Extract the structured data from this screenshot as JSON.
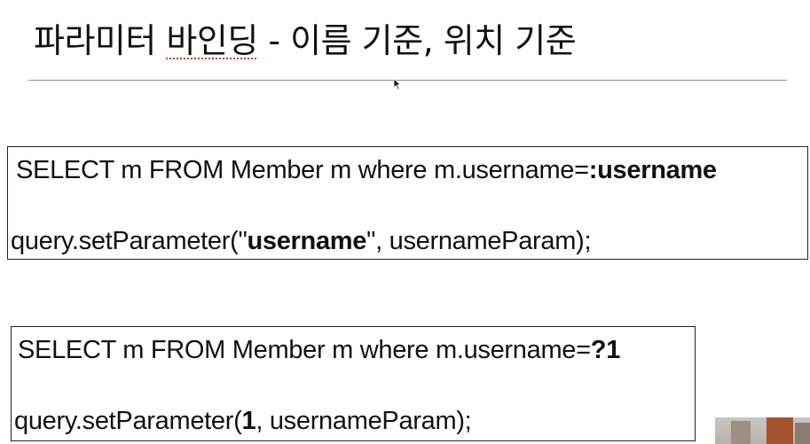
{
  "slide": {
    "title_main": "파라미터 ",
    "title_underlined": "바인딩",
    "title_rest": " - 이름 기준, 위치 기준"
  },
  "named_example": {
    "query_prefix": "SELECT m FROM Member m where m.username=",
    "query_param": ":username",
    "call_prefix": "query.setParameter(\"",
    "call_param": "username",
    "call_suffix": "\", usernameParam);"
  },
  "positional_example": {
    "query_prefix": "SELECT m FROM Member m where m.username=",
    "query_param": "?1",
    "call_prefix": "query.setParameter(",
    "call_param": "1",
    "call_suffix": ", usernameParam);"
  },
  "icons": {
    "cursor": "mouse-pointer-icon",
    "spellcheck": "spellcheck-underline"
  },
  "colors": {
    "text": "#111111",
    "divider": "#8f8f8f",
    "box_border": "#222222",
    "spellcheck": "#d43b3b"
  }
}
